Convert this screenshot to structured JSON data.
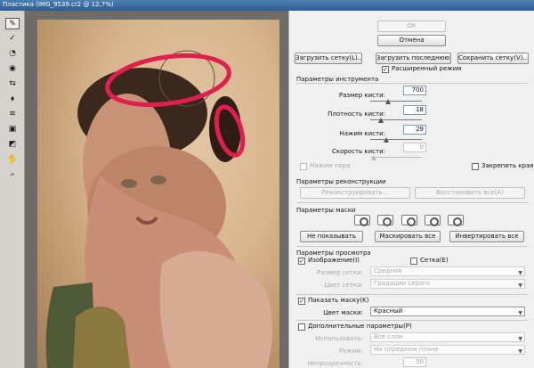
{
  "window": {
    "title": "Пластика (IMG_9539.cr2 @ 12,7%)"
  },
  "toolbar": {
    "tools": [
      "warp-tool-icon",
      "reconstruct-tool-icon",
      "pucker-tool-icon",
      "bloat-tool-icon",
      "push-left-tool-icon",
      "mirror-tool-icon",
      "turbulence-tool-icon",
      "freeze-mask-tool-icon",
      "thaw-mask-tool-icon",
      "hand-tool-icon",
      "zoom-tool-icon"
    ]
  },
  "panel": {
    "ok": "ОК",
    "cancel": "Отмена",
    "load_mesh": "Загрузить сетку(L)...",
    "load_last_mesh": "Загрузить последнюю сетку",
    "save_mesh": "Сохранить сетку(V)...",
    "advanced_mode": "Расширенный режим",
    "tool_params": "Параметры инструмента",
    "brush_size": {
      "label": "Размер кисти:",
      "value": "700"
    },
    "brush_density": {
      "label": "Плотность кисти:",
      "value": "18"
    },
    "brush_pressure": {
      "label": "Нажим кисти:",
      "value": "29"
    },
    "brush_rate": {
      "label": "Скорость кисти:",
      "value": "0"
    },
    "stylus_pressure": "Нажим пера",
    "pin_edges": "Закрепить края",
    "reconstruct_params": "Параметры реконструкции",
    "reconstruct": "Реконструировать...",
    "restore_all": "Восстановить все(A)",
    "mask_params": "Параметры маски",
    "hide_mask": "Не показывать",
    "mask_all": "Маскировать все",
    "invert_all": "Инвертировать все",
    "view_params": "Параметры просмотра",
    "show_image": "Изображение(I)",
    "show_mesh": "Сетка(E)",
    "mesh_size": {
      "label": "Размер сетки:",
      "value": "Средняя"
    },
    "mesh_color": {
      "label": "Цвет сетки:",
      "value": "Градации серого"
    },
    "show_mask": "Показать маску(K)",
    "mask_color": {
      "label": "Цвет маски:",
      "value": "Красный"
    },
    "extra_params": "Дополнительные параметры(P)",
    "use": {
      "label": "Использовать:",
      "value": "Все слои"
    },
    "mode": {
      "label": "Режим:",
      "value": "На переднем плане"
    },
    "opacity": {
      "label": "Непрозрачность:",
      "value": "50"
    }
  },
  "colors": {
    "annotation": "#e01f50",
    "panel": "#f0f0f0"
  }
}
